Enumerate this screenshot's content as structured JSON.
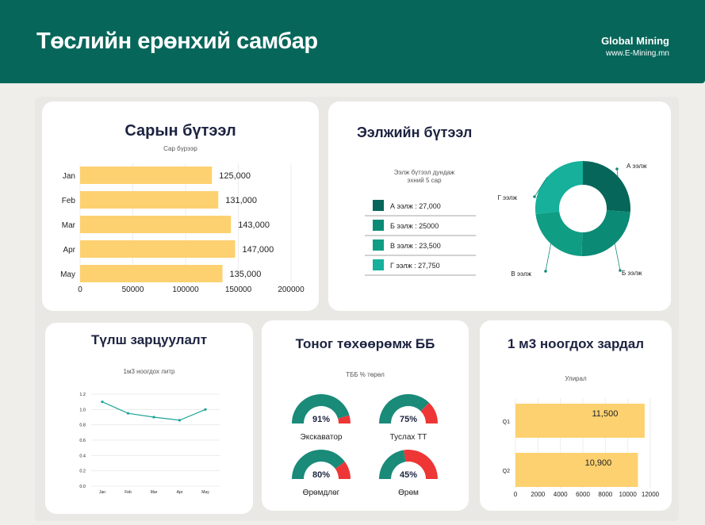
{
  "header": {
    "title": "Төслийн ерөнхий самбар",
    "brand_name": "Global Mining",
    "brand_url": "www.E-Mining.mn"
  },
  "monthly": {
    "title": "Сарын бүтээл",
    "subtitle": "Сар бүрээр"
  },
  "shifts": {
    "title": "Ээлжийн бүтээл",
    "subtitle": "Ээлж бүтээл дундаж\nэхний 5 сар",
    "legend": [
      "А ээлж : 27,000",
      "Б ээлж : 25000",
      "В ээлж : 23,500",
      "Г ээлж : 27,750"
    ]
  },
  "fuel": {
    "title": "Түлш зарцуулалт",
    "subtitle": "1м3 ноогдох литр"
  },
  "equipment": {
    "title": "Тоног төхөөрөмж ББ",
    "subtitle": "ТББ % төрөл",
    "gauges": [
      {
        "label": "Экскаватор",
        "value_text": "91%",
        "value": 0.91
      },
      {
        "label": "Туслах ТТ",
        "value_text": "75%",
        "value": 0.75
      },
      {
        "label": "Өрөмдлөг",
        "value_text": "80%",
        "value": 0.8
      },
      {
        "label": "Өрөм",
        "value_text": "45%",
        "value": 0.45
      }
    ]
  },
  "cost": {
    "title": "1 м3 ноогдох зардал",
    "subtitle": "Улирал"
  },
  "colors": {
    "header": "#07665a",
    "bar": "#fdd170",
    "shift_a": "#07665a",
    "shift_b": "#0b8a76",
    "shift_c": "#0f9d84",
    "shift_d": "#16b09b",
    "gauge_fill": "#1a8a79",
    "gauge_rest": "#ee3636"
  },
  "chart_data": [
    {
      "type": "bar",
      "orientation": "horizontal",
      "categories": [
        "Jan",
        "Feb",
        "Mar",
        "Apr",
        "May"
      ],
      "values": [
        125000,
        131000,
        143000,
        147000,
        135000
      ],
      "data_labels": [
        "125,000",
        "131,000",
        "143,000",
        "147,000",
        "135,000"
      ],
      "xlim": [
        0,
        200000
      ],
      "xticks": [
        "0",
        "50000",
        "100000",
        "150000",
        "200000"
      ]
    },
    {
      "type": "pie",
      "donut": true,
      "categories": [
        "А ээлж",
        "Б ээлж",
        "В ээлж",
        "Г ээлж"
      ],
      "values": [
        27000,
        25000,
        23500,
        27750
      ]
    },
    {
      "type": "line",
      "x": [
        "Jan",
        "Feb",
        "Mar",
        "Apr",
        "May"
      ],
      "values": [
        1.1,
        0.95,
        0.9,
        0.86,
        1.0
      ],
      "ylim": [
        0,
        1.2
      ],
      "yticks": [
        "0.0",
        "0.2",
        "0.4",
        "0.6",
        "0.8",
        "1.0",
        "1.2"
      ]
    },
    {
      "type": "bar",
      "orientation": "horizontal",
      "categories": [
        "Q1",
        "Q2"
      ],
      "values": [
        11500,
        10900
      ],
      "data_labels": [
        "11,500",
        "10,900"
      ],
      "xlim": [
        0,
        12000
      ],
      "xticks": [
        "0",
        "2000",
        "4000",
        "6000",
        "8000",
        "10000",
        "12000"
      ]
    }
  ]
}
